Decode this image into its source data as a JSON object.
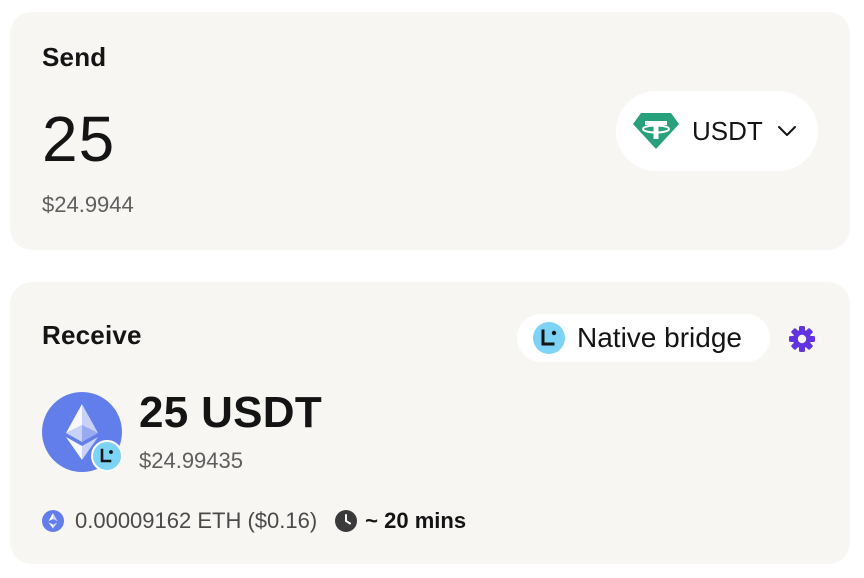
{
  "send": {
    "title": "Send",
    "amount": "25",
    "fiat_value": "$24.9944",
    "token": {
      "label": "USDT",
      "icon": "tether-icon",
      "color": "#26a17b"
    }
  },
  "receive": {
    "title": "Receive",
    "bridge": {
      "label": "Native bridge",
      "icon": "bridge-logo-icon",
      "color": "#7dd3f5"
    },
    "settings_icon": "gear-icon",
    "accent_color": "#6233e0",
    "amount": "25 USDT",
    "fiat_value": "$24.99435",
    "asset_icon": "ethereum-icon",
    "asset_color": "#627eea",
    "gas_fee": "0.00009162 ETH ($0.16)",
    "eta": "~ 20 mins"
  }
}
